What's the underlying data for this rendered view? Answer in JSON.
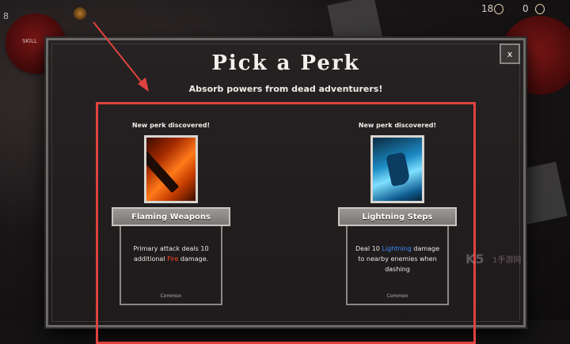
{
  "hud": {
    "left_number": "8",
    "orb_label": "SKILL",
    "stat_a": "18",
    "stat_b": "0"
  },
  "modal": {
    "title": "Pick a Perk",
    "subtitle": "Absorb powers from dead adventurers!",
    "close_label": "x"
  },
  "perks": [
    {
      "discovered_text": "New perk discovered!",
      "name": "Flaming Weapons",
      "desc_before": "Primary attack deals 10 additional ",
      "keyword": "Fire",
      "desc_after": " damage.",
      "rarity": "Common",
      "icon": "flaming-sword-icon",
      "keyword_color": "#ff4a1e"
    },
    {
      "discovered_text": "New perk discovered!",
      "name": "Lightning Steps",
      "desc_before": "Deal 10 ",
      "keyword": "Lightning",
      "desc_after": " damage to nearby enemies when dashing",
      "rarity": "Common",
      "icon": "lightning-boot-icon",
      "keyword_color": "#3f8dff"
    }
  ],
  "watermark": {
    "main": "K5",
    "sub": "1手游网"
  },
  "colors": {
    "highlight": "#e0423f",
    "panel": "#262223"
  }
}
